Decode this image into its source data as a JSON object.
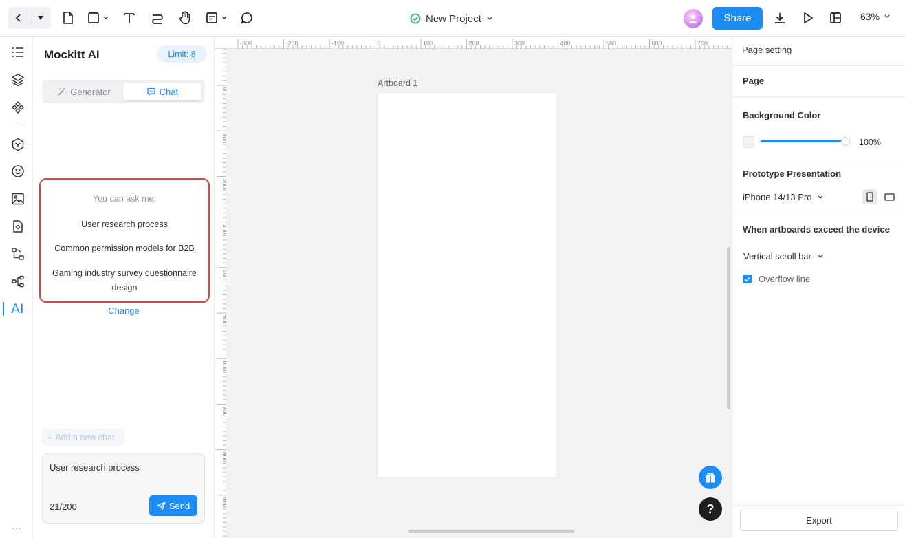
{
  "toolbar": {
    "project_name": "New Project",
    "share_label": "Share",
    "zoom": "63%"
  },
  "sidebar": {
    "ai_label": "AI",
    "more": "..."
  },
  "ai_panel": {
    "title": "Mockitt AI",
    "limit": "Limit: 8",
    "tabs": {
      "generator": "Generator",
      "chat": "Chat"
    },
    "ask_label": "You can ask me:",
    "suggestions": [
      "User research process",
      "Common permission models for B2B",
      "Gaming industry survey questionnaire design"
    ],
    "change_label": "Change",
    "add_chat_label": "Add a new chat",
    "input_value": "User research process",
    "char_count": "21/200",
    "send_label": "Send"
  },
  "canvas": {
    "artboard_name": "Artboard 1",
    "ruler_top": [
      "-300",
      "-200",
      "-100",
      "0",
      "100",
      "200",
      "300",
      "400",
      "500",
      "600",
      "700"
    ],
    "ruler_left": [
      "0",
      "100",
      "200",
      "300",
      "400",
      "500",
      "600",
      "700",
      "800",
      "900"
    ],
    "help_label": "?"
  },
  "right_panel": {
    "page_setting": "Page setting",
    "page": "Page",
    "background_color": "Background Color",
    "opacity": "100%",
    "prototype_presentation": "Prototype Presentation",
    "device": "iPhone 14/13 Pro",
    "exceed_title": "When artboards exceed the device",
    "scroll_mode": "Vertical scroll bar",
    "overflow_label": "Overflow line",
    "export_label": "Export"
  },
  "colors": {
    "accent": "#1e8cf5",
    "highlight_border": "#d9453a"
  }
}
